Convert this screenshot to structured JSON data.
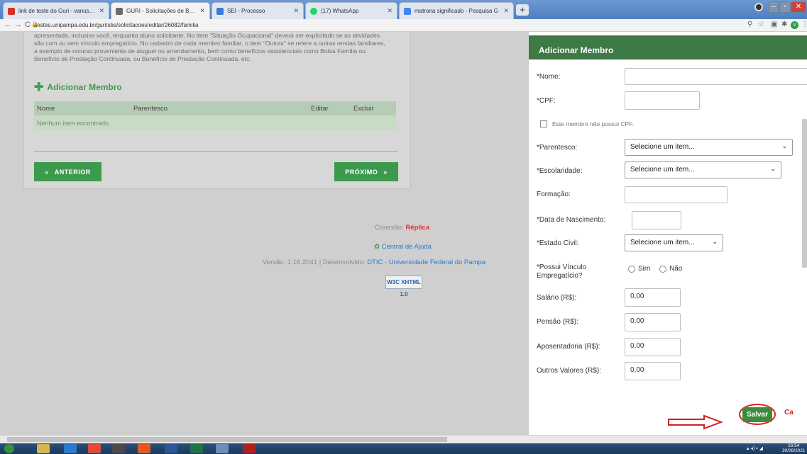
{
  "browser": {
    "tabs": [
      {
        "title": "link de teste do Guri - vanusaoli",
        "color": "#d93025"
      },
      {
        "title": "GURI - Solicitações de Benefícios",
        "color": "#6b6b6b"
      },
      {
        "title": "SEI - Processo",
        "color": "#3a7bd5"
      },
      {
        "title": "(17) WhatsApp",
        "color": "#25d366"
      },
      {
        "title": "matrona significado - Pesquisa G",
        "color": "#4285f4"
      }
    ],
    "new_tab": "+",
    "url": "testes.unipampa.edu.br/guri/sbs/solicitacoes/editar/26082/familia"
  },
  "page": {
    "intro_lines": [
      "apresentada, inclusive você, enquanto aluno solicitante. No item \"Situação Ocupacional\" deverá ser explicitado se as atividades",
      "são com ou sem vínculo empregatício. No cadastro de cada membro familiar, o item \"Outras\" se refere a outras rendas familiares,",
      "a exemplo de recurso proveniente de aluguel ou arrendamento, bem como benefícios assistenciais como Bolsa Família ou",
      "Benefício de Prestação Continuada, ou Benefício de Prestação Continuada, etc."
    ],
    "add_member": "Adicionar Membro",
    "table": {
      "headers": [
        "Nome",
        "Parentesco",
        "Editar",
        "Excluir"
      ],
      "empty": "Nenhum item encontrado."
    },
    "prev_button": "ANTERIOR",
    "next_button": "PRÓXIMO",
    "footer": {
      "connection_label": "Conexão:",
      "connection_value": "Réplica",
      "help": "Central de Ajuda",
      "version": "Versão: 1.16.2041 | Desenvolvido:",
      "developer": "DTIC - Universidade Federal do Pampa",
      "w3c": "W3C XHTML 1.0"
    }
  },
  "modal": {
    "title": "Adicionar Membro",
    "fields": {
      "nome": {
        "label": "*Nome:",
        "value": ""
      },
      "cpf": {
        "label": "*CPF:",
        "value": ""
      },
      "no_cpf": "Este membro não possui CPF.",
      "parentesco": {
        "label": "*Parentesco:",
        "value": "Selecione um item..."
      },
      "escolaridade": {
        "label": "*Escolaridade:",
        "value": "Selecione um item..."
      },
      "formacao": {
        "label": "Formação:",
        "value": ""
      },
      "nascimento": {
        "label": "*Data de Nascimento:",
        "value": ""
      },
      "estado_civil": {
        "label": "*Estado Civil:",
        "value": "Selecione um item..."
      },
      "vinculo": {
        "label_1": "*Possui Vínculo",
        "label_2": "Empregatício?",
        "sim": "Sim",
        "nao": "Não"
      },
      "salario": {
        "label": "Salário (R$):",
        "value": "0,00"
      },
      "pensao": {
        "label": "Pensão (R$):",
        "value": "0,00"
      },
      "aposentadoria": {
        "label": "Aposentadoria (R$):",
        "value": "0,00"
      },
      "outros": {
        "label": "Outros Valores (R$):",
        "value": "0,00"
      }
    },
    "save_button": "Salvar",
    "cancel_button": "Ca"
  },
  "taskbar": {
    "time": "16:54",
    "date": "30/08/2021"
  },
  "colors": {
    "primary_green": "#3c9a4d",
    "modal_header": "#3d7a45",
    "replica": "#e03030",
    "link_blue": "#2a7ad0",
    "annotation_red": "#d22222"
  }
}
